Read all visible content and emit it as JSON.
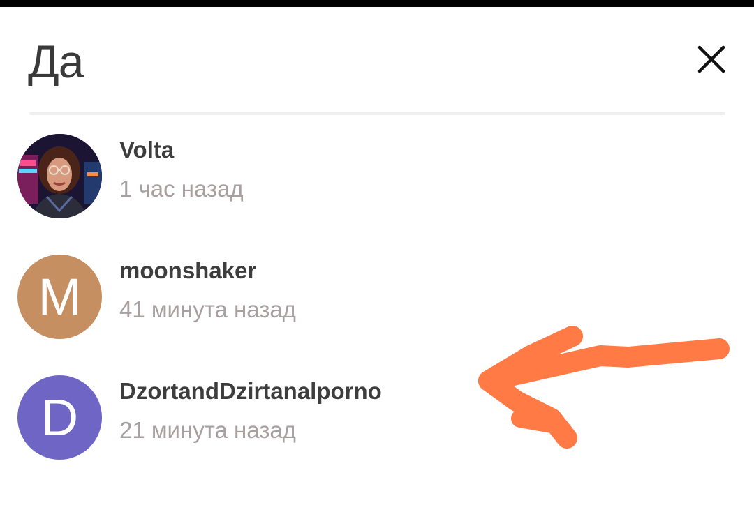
{
  "dialog": {
    "title": "Да",
    "close_icon": "close-icon"
  },
  "users": [
    {
      "name": "Volta",
      "time": "1 час назад",
      "avatar_type": "photo"
    },
    {
      "name": "moonshaker",
      "time": "41 минута назад",
      "avatar_type": "letter",
      "letter": "M",
      "color": "#c68f62"
    },
    {
      "name": "DzortandDzirtanalporno",
      "time": "21 минута назад",
      "avatar_type": "letter",
      "letter": "D",
      "color": "#6e65c4"
    }
  ],
  "colors": {
    "title": "#3a3a3a",
    "name": "#3d3d3d",
    "time": "#a89fa0",
    "divider": "#efefef",
    "annotation_arrow": "#ff7a45"
  }
}
